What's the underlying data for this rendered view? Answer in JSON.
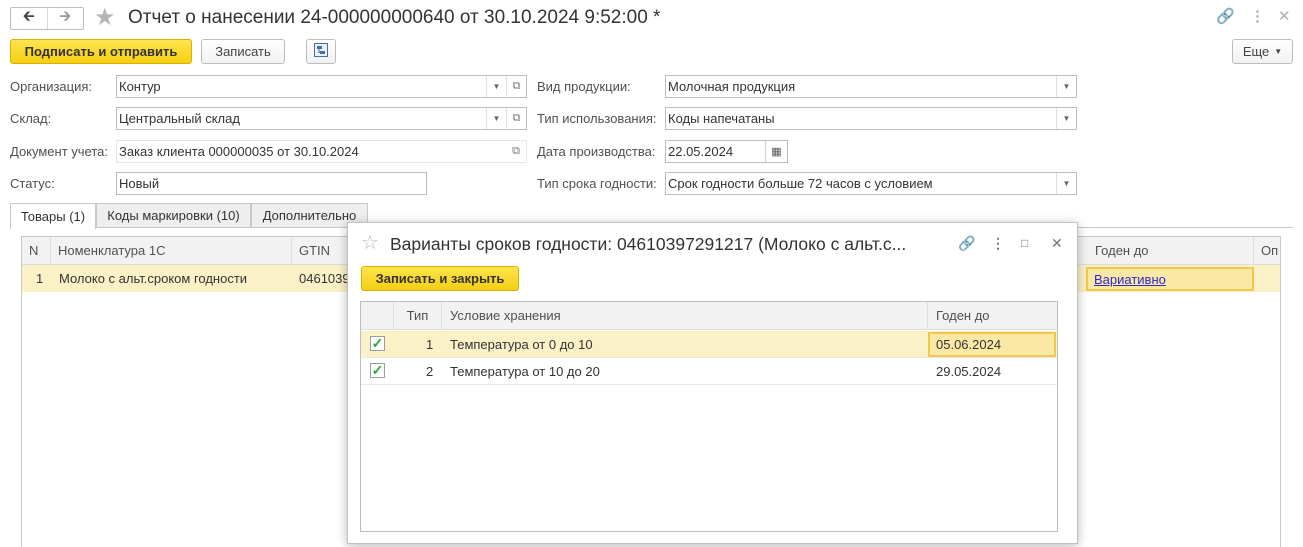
{
  "window": {
    "back_icon": "arrow-left-icon",
    "forward_icon": "arrow-right-icon",
    "title": "Отчет о нанесении 24-000000000640 от 30.10.2024 9:52:00 *",
    "link_icon": "link-icon",
    "menu_icon": "more-vertical-icon",
    "close_icon": "close-icon"
  },
  "toolbar": {
    "sign_send_label": "Подписать и отправить",
    "save_label": "Записать",
    "more_label": "Еще",
    "report_icon": "structure-icon"
  },
  "form": {
    "organization": {
      "label": "Организация:",
      "value": "Контур"
    },
    "warehouse": {
      "label": "Склад:",
      "value": "Центральный склад"
    },
    "accounting_doc": {
      "label": "Документ учета:",
      "value": "Заказ клиента 000000035 от 30.10.2024"
    },
    "status": {
      "label": "Статус:",
      "value": "Новый"
    },
    "product_type": {
      "label": "Вид продукции:",
      "value": "Молочная продукция"
    },
    "usage_type": {
      "label": "Тип использования:",
      "value": "Коды напечатаны"
    },
    "production_date": {
      "label": "Дата производства:",
      "value": "22.05.2024"
    },
    "shelf_life_type": {
      "label": "Тип срока годности:",
      "value": "Срок годности больше 72 часов с условием"
    }
  },
  "tabs": [
    {
      "label": "Товары (1)",
      "active": true
    },
    {
      "label": "Коды маркировки (10)",
      "active": false
    },
    {
      "label": "Дополнительно",
      "active": false
    }
  ],
  "goods_table": {
    "columns": [
      "N",
      "Номенклатура 1С",
      "GTIN",
      "Годен до",
      "Оп"
    ],
    "rows": [
      {
        "n": "1",
        "name": "Молоко с альт.сроком годности",
        "gtin": "0461039",
        "expiry": "Вариативно"
      }
    ]
  },
  "modal": {
    "title": "Варианты сроков годности: 04610397291217 (Молоко с альт.с...",
    "save_close_label": "Записать и закрыть",
    "columns": [
      "Тип",
      "Условие хранения",
      "Годен до"
    ],
    "rows": [
      {
        "checked": true,
        "type": "1",
        "condition": "Температура от 0 до 10",
        "expiry": "05.06.2024"
      },
      {
        "checked": true,
        "type": "2",
        "condition": "Температура от 10 до 20",
        "expiry": "29.05.2024"
      }
    ]
  }
}
